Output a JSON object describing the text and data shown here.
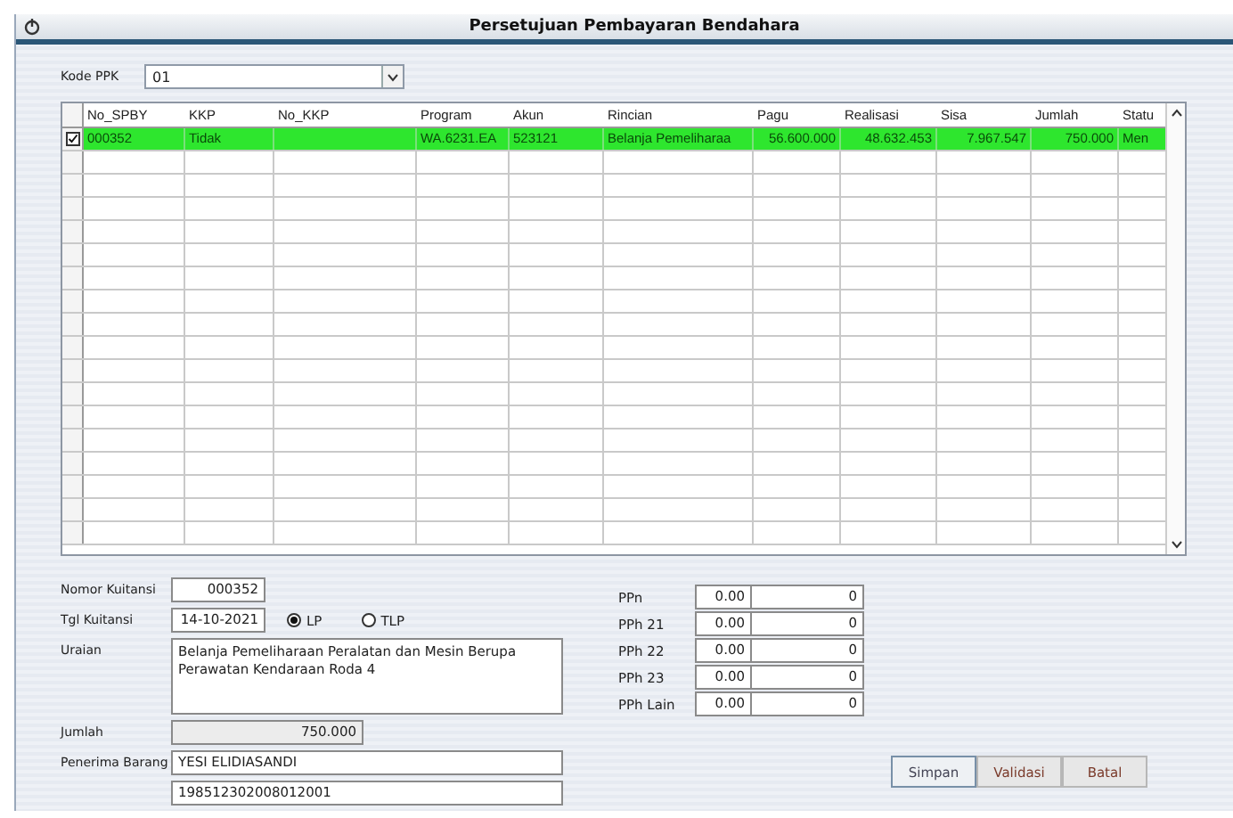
{
  "window": {
    "title": "Persetujuan Pembayaran Bendahara"
  },
  "kode_ppk": {
    "label": "Kode PPK",
    "value": "01"
  },
  "table": {
    "columns": [
      "No_SPBY",
      "KKP",
      "No_KKP",
      "Program",
      "Akun",
      "Rincian",
      "Pagu",
      "Realisasi",
      "Sisa",
      "Jumlah",
      "Statu"
    ],
    "rows": [
      {
        "checked": true,
        "selected": true,
        "cells": [
          "000352",
          "Tidak",
          "",
          "WA.6231.EA",
          "523121",
          "Belanja Pemeliharaa",
          "56.600.000",
          "48.632.453",
          "7.967.547",
          "750.000",
          "Men"
        ]
      }
    ]
  },
  "form": {
    "nomor_kuitansi": {
      "label": "Nomor Kuitansi",
      "value": "000352"
    },
    "tgl_kuitansi": {
      "label": "Tgl Kuitansi",
      "value": "14-10-2021"
    },
    "jenis": [
      {
        "label": "LP",
        "selected": true
      },
      {
        "label": "TLP",
        "selected": false
      }
    ],
    "uraian": {
      "label": "Uraian",
      "value": "Belanja Pemeliharaan Peralatan dan Mesin Berupa Perawatan Kendaraan Roda 4"
    },
    "jumlah": {
      "label": "Jumlah",
      "value": "750.000"
    },
    "penerima": {
      "label": "Penerima Barang",
      "name": "YESI ELIDIASANDI",
      "nip": "198512302008012001"
    }
  },
  "pajak": [
    {
      "label": "PPn",
      "rate": "0.00",
      "amount": "0"
    },
    {
      "label": "PPh 21",
      "rate": "0.00",
      "amount": "0"
    },
    {
      "label": "PPh 22",
      "rate": "0.00",
      "amount": "0"
    },
    {
      "label": "PPh 23",
      "rate": "0.00",
      "amount": "0"
    },
    {
      "label": "PPh Lain",
      "rate": "0.00",
      "amount": "0"
    }
  ],
  "buttons": [
    "Simpan",
    "Validasi",
    "Batal"
  ]
}
